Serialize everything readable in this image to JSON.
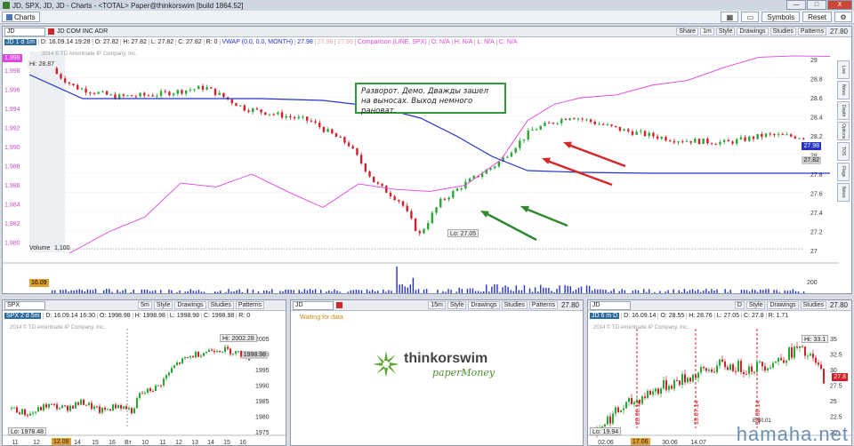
{
  "window": {
    "title": "JD, SPX, JD, JD - Charts - <TOTAL> Paper@thinkorswim [build 1864.52]",
    "controls": [
      "—",
      "□",
      "X"
    ]
  },
  "menubar": {
    "charts_label": "Charts",
    "symbols_label": "Symbols",
    "reset_label": "Reset"
  },
  "main": {
    "symbol": "JD",
    "company": "JD COM INC ADR",
    "tools": [
      "Share",
      "1m",
      "Style",
      "Drawings",
      "Studies",
      "Patterns"
    ],
    "price_top": "27.80",
    "status": {
      "tag": "JD 1 d 1m",
      "values": [
        "D: 16.09.14 19:28",
        "O: 27.82",
        "H: 27.82",
        "L: 27.82",
        "C: 27.82",
        "R: 0",
        "VWAP (0.0, 0.0, MONTH)",
        "27.98",
        "27.98",
        "27.98",
        "Comparison (LINE, SPX)",
        "O: N/A",
        "H: N/A",
        "L: N/A",
        "C: N/A"
      ]
    },
    "copyright": "2014 © TD Ameritrade IP Company, Inc.",
    "hi_label": "Hi: 28.87",
    "lo_label": "Lo: 27.05",
    "annotation": "Разворот. Демо. Дважды зашел на выносах. Выход немного рановат.",
    "volume_label": "Volume",
    "volume_value": "1,100",
    "volume_scale": "200",
    "left_scale": [
      "1,998",
      "1,996",
      "1,994",
      "1,992",
      "1,990",
      "1,988",
      "1,986",
      "1,984",
      "1,982",
      "1,980"
    ],
    "left_top_tag": "1,999",
    "right_scale": [
      "29",
      "28.8",
      "28.6",
      "28.4",
      "28.2",
      "28",
      "27.8",
      "27.6",
      "27.4",
      "27.2",
      "27"
    ],
    "vwap_tag": "27.98",
    "last_tag": "27.82",
    "date_tag": "16.09",
    "time_axis": [
      "9:09",
      "9:45",
      "10:00",
      "10:15",
      "10:30",
      "10:45",
      "11:00",
      "11:15",
      "11:30",
      "11:45",
      "12:00",
      "12:15",
      "12:30",
      "12:40"
    ],
    "side_tabs": [
      "Live",
      "News",
      "Depth",
      "Options",
      "TOS",
      "Flags",
      "News"
    ],
    "colors": {
      "up": "#26a832",
      "down": "#d41f2a",
      "vwap": "#2432c9",
      "comparison": "#e043e0",
      "arrow_red": "#d42828",
      "arrow_green": "#2f8a2f"
    }
  },
  "spx": {
    "symbol": "SPX",
    "tools": [
      "5m",
      "Style",
      "Drawings",
      "Studies",
      "Patterns"
    ],
    "price_top": "1998.98",
    "status": {
      "tag": "SPX 2 d 5m",
      "values": [
        "D: 16.09.14 16:30",
        "O: 1998.98",
        "H: 1998.98",
        "L: 1998.98",
        "C: 1998.98",
        "R: 0"
      ]
    },
    "copyright": "2014 © TD Ameritrade IP Company, Inc.",
    "hi_label": "Hi: 2002.28",
    "lo_label": "Lo: 1978.48",
    "price_tag": "1998.98",
    "right_scale": [
      "2005",
      "2000",
      "1995",
      "1990",
      "1985",
      "1980",
      "1975"
    ],
    "date_tag": "12.09",
    "time_axis": [
      "11",
      "12",
      "13",
      "14",
      "15",
      "16",
      "Вт",
      "10",
      "11",
      "12",
      "13",
      "14",
      "15",
      "16"
    ]
  },
  "middle": {
    "symbol": "JD",
    "tools": [
      "15m",
      "Style",
      "Drawings",
      "Studies",
      "Patterns"
    ],
    "price_top": "27.80",
    "waiting": "Waiting for data",
    "brand": "thinkorswim",
    "paper": "paperMoney"
  },
  "jd6m": {
    "symbol": "JD",
    "price_top": "27.80",
    "status": {
      "tag": "JD 6 m D",
      "values": [
        "D: 16.09.14",
        "O: 28.55",
        "H: 28.76",
        "L: 27.05",
        "C: 27.8",
        "R: 1.71"
      ]
    },
    "copyright": "2014 © TD Ameritrade IP Company, Inc.",
    "hi_label": "Hi: 33.1",
    "lo_label": "Lo: 19.94",
    "price_tag": "27.8",
    "right_scale": [
      "35",
      "32.5",
      "30",
      "27.5",
      "25",
      "22.5",
      "20"
    ],
    "events": [
      "20.06.14",
      "19.07.14",
      "18.08.14"
    ],
    "earnings": "E:$0.01",
    "date_tag": "17.06",
    "time_axis": [
      "02.06",
      "08.07",
      "30.06",
      "14.07"
    ]
  },
  "watermark": "hamaha.net"
}
